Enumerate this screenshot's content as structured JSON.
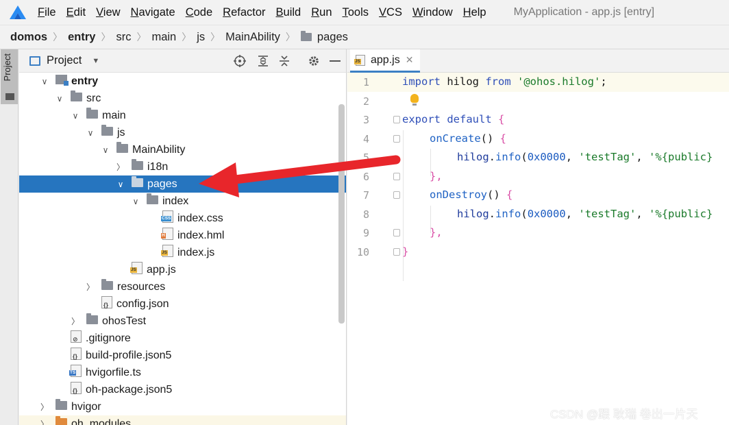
{
  "menubar": {
    "items": [
      {
        "mnemonic": "F",
        "rest": "ile"
      },
      {
        "mnemonic": "E",
        "rest": "dit"
      },
      {
        "mnemonic": "V",
        "rest": "iew"
      },
      {
        "mnemonic": "N",
        "rest": "avigate"
      },
      {
        "mnemonic": "C",
        "rest": "ode"
      },
      {
        "mnemonic": "R",
        "rest": "efactor"
      },
      {
        "mnemonic": "B",
        "rest": "uild"
      },
      {
        "mnemonic": "R",
        "rest": "un"
      },
      {
        "mnemonic": "T",
        "rest": "ools"
      },
      {
        "mnemonic": "V",
        "rest": "CS"
      },
      {
        "mnemonic": "W",
        "rest": "indow"
      },
      {
        "mnemonic": "H",
        "rest": "elp"
      }
    ],
    "window_title": "MyApplication - app.js [entry]"
  },
  "breadcrumb": {
    "items": [
      "domos",
      "entry",
      "src",
      "main",
      "js",
      "MainAbility",
      "pages"
    ]
  },
  "toolstrip": {
    "label": "Project"
  },
  "project_panel": {
    "title": "Project",
    "tree": [
      {
        "label": "entry",
        "bold": true
      },
      {
        "label": "src"
      },
      {
        "label": "main"
      },
      {
        "label": "js"
      },
      {
        "label": "MainAbility"
      },
      {
        "label": "i18n"
      },
      {
        "label": "pages",
        "selected": true
      },
      {
        "label": "index"
      },
      {
        "label": "index.css"
      },
      {
        "label": "index.hml"
      },
      {
        "label": "index.js"
      },
      {
        "label": "app.js"
      },
      {
        "label": "resources"
      },
      {
        "label": "config.json"
      },
      {
        "label": "ohosTest"
      },
      {
        "label": ".gitignore"
      },
      {
        "label": "build-profile.json5"
      },
      {
        "label": "hvigorfile.ts"
      },
      {
        "label": "oh-package.json5"
      },
      {
        "label": "hvigor"
      },
      {
        "label": "oh_modules"
      }
    ]
  },
  "editor": {
    "tab_label": "app.js",
    "line_numbers": [
      "1",
      "2",
      "3",
      "4",
      "5",
      "6",
      "7",
      "8",
      "9",
      "10"
    ],
    "code": {
      "l1_import": "import",
      "l1_hilog": " hilog ",
      "l1_from": "from",
      "l1_str": " '@ohos.hilog'",
      "l1_semi": ";",
      "l3_export": "export",
      "l3_default": " default ",
      "l3_brace": "{",
      "l4_fn": "onCreate",
      "l4_paren": "() ",
      "l4_brace": "{",
      "l5_obj": "hilog",
      "l5_dot": ".",
      "l5_info": "info",
      "l5_open": "(",
      "l5_num": "0x0000",
      "l5_comma": ", ",
      "l5_tag": "'testTag'",
      "l5_comma2": ", ",
      "l5_fmt": "'%{public}",
      "l6_close": "},",
      "l7_fn": "onDestroy",
      "l7_paren": "() ",
      "l7_brace": "{",
      "l8_obj": "hilog",
      "l8_dot": ".",
      "l8_info": "info",
      "l8_open": "(",
      "l8_num": "0x0000",
      "l8_comma": ", ",
      "l8_tag": "'testTag'",
      "l8_comma2": ", ",
      "l8_fmt": "'%{public}",
      "l9_close": "},",
      "l10_close": "}"
    }
  },
  "watermark": "CSDN @跟 耿瑞 卷出一片天",
  "colors": {
    "selection": "#2675bf",
    "arrow": "#e8262b",
    "keyword": "#2f4fb8",
    "string": "#1a7a2a",
    "function": "#1f62c4"
  }
}
